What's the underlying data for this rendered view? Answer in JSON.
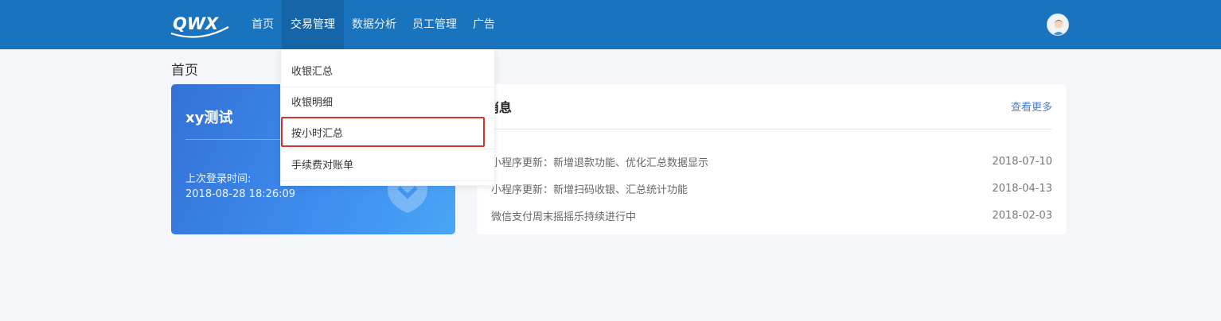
{
  "header": {
    "logo_text": "QWX",
    "nav": [
      {
        "label": "首页"
      },
      {
        "label": "交易管理"
      },
      {
        "label": "数据分析"
      },
      {
        "label": "员工管理"
      },
      {
        "label": "广告"
      }
    ],
    "active_index": 1
  },
  "breadcrumb": {
    "title": "首页"
  },
  "user_card": {
    "name": "xy测试",
    "last_login_label": "上次登录时间:",
    "last_login_time": "2018-08-28 18:26:09"
  },
  "messages": {
    "title": "消息",
    "more_label": "查看更多",
    "items": [
      {
        "text": "小程序更新：新增退款功能、优化汇总数据显示",
        "date": "2018-07-10"
      },
      {
        "text": "小程序更新：新增扫码收银、汇总统计功能",
        "date": "2018-04-13"
      },
      {
        "text": "微信支付周末摇摇乐持续进行中",
        "date": "2018-02-03"
      }
    ]
  },
  "dropdown": {
    "items": [
      {
        "label": "收银汇总"
      },
      {
        "label": "收银明细"
      },
      {
        "label": "按小时汇总"
      },
      {
        "label": "手续费对账单"
      }
    ],
    "highlighted_index": 2
  },
  "colors": {
    "header_bg": "#1a73bd",
    "highlight_border": "#d8322a",
    "link": "#4a7fc1"
  }
}
